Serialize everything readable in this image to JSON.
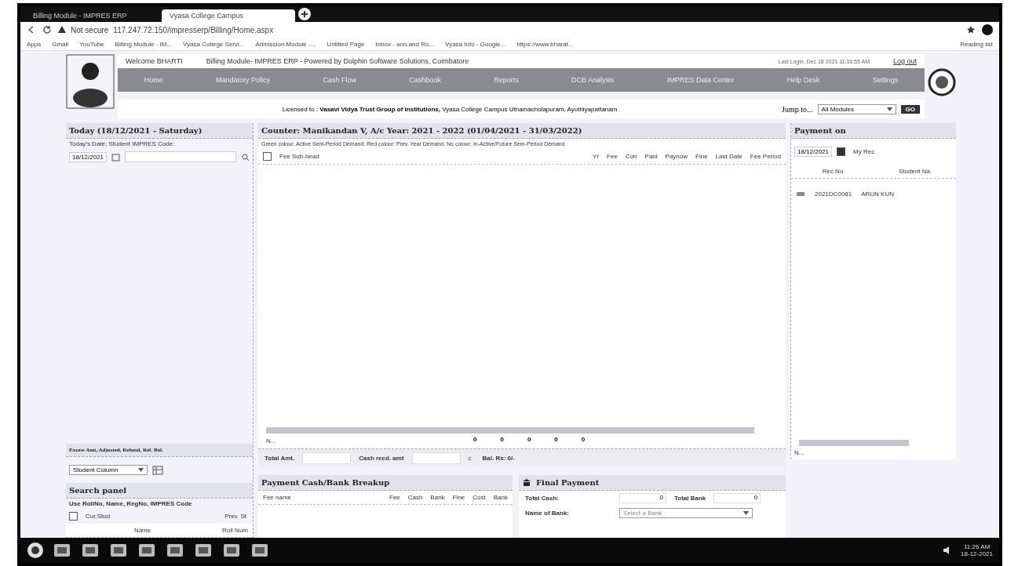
{
  "browser": {
    "tabs": [
      {
        "label": "Billing Module - IMPRES ERP",
        "selected": false
      },
      {
        "label": "Vyasa College Campus",
        "selected": true
      }
    ],
    "address": {
      "security": "Not secure",
      "url": "117.247.72.150/impresserp/Billing/Home.aspx"
    },
    "bookmarks": [
      "Apps",
      "Gmail",
      "YouTube",
      "Billing Module - IM...",
      "Vyasa College Servi...",
      "Admission Module -...",
      "Untitled Page",
      "Inbox - ann.and Ro...",
      "Vyasa Info - Google...",
      "https://www.bharat..."
    ],
    "reading_list": "Reading list"
  },
  "header": {
    "welcome": "Welcome BHARTI",
    "title": "Billing Module- IMPRES ERP - Powered by Dolphin Software Solutions, Coimbatore",
    "last_login": "Last Login: Dec 18 2021 11:16:55 AM",
    "logout": "Log out",
    "nav": [
      "Home",
      "Mandatory Policy",
      "Cash Flow",
      "Cashbook",
      "Reports",
      "DCB Analysis",
      "IMPRES Data Center",
      "Help Desk",
      "Settings"
    ],
    "licensed_label": "Licensed to :",
    "licensee": "Vasavi Vidya Trust Group of Institutions,",
    "address": "Vyasa College Campus Uthamacholapuram, Ayothiyapattanam",
    "jump_label": "Jump to...",
    "jump_value": "All Modules",
    "go": "GO"
  },
  "left": {
    "title": "Today (18/12/2021 - Saturday)",
    "prompt": "Today's Date, Student IMPRES Code:",
    "date": "18/12/2021",
    "excess_title": "Excess Amt, Adjusted, Refund, Ref. Bal.",
    "excess_select": "Student Column",
    "search": {
      "title": "Search panel",
      "hint": "Use RollNo, Name, RegNo, IMPRES Code",
      "current_label": "Cur.Stud",
      "current_checked": false,
      "prev_label": "Prev. St",
      "columns": [
        "Name",
        "Roll Num"
      ]
    }
  },
  "center": {
    "title": "Counter: Manikandan V, A/c Year: 2021 - 2022 (01/04/2021 - 31/03/2022)",
    "legend": "Green colour: Active Sem-Period Demand. Red colour: Prev. Year Demand. No colour: In-Active/Future Sem-Period Demand",
    "select_all_checked": false,
    "columns": [
      "Fee Sub-head",
      "Yr",
      "Fee",
      "Con",
      "Paid",
      "Paynow",
      "Fine",
      "Last Date",
      "Fee Period"
    ],
    "footer_label": "N...",
    "footer_totals": [
      "0",
      "0",
      "0",
      "0",
      "0"
    ],
    "total_label": "Total Amt.",
    "cash_label": "Cash recd. amt",
    "cash_suffix": "c",
    "balance": "Bal. Rs: 0/-"
  },
  "breakup": {
    "title": "Payment Cash/Bank Breakup",
    "columns": [
      "Fee name",
      "Fee",
      "Cash",
      "Bank",
      "Fine",
      "Cost",
      "Bank"
    ]
  },
  "right": {
    "title": "Payment on",
    "date": "18/12/2021",
    "my_rec_label": "My Rec",
    "my_rec_checked": true,
    "columns": [
      "Rec No",
      "Student Na"
    ],
    "rows": [
      [
        "2021DC0081",
        "ARUN KUN"
      ]
    ],
    "footer_label": "N..."
  },
  "final": {
    "title": "Final Payment",
    "total_cash_label": "Total Cash:",
    "total_cash": "0",
    "total_bank_label": "Total Bank",
    "total_bank": "0",
    "bank_label": "Name of Bank:",
    "bank_placeholder": "Select a Bank"
  },
  "taskbar": {
    "time": "11:26 AM",
    "date": "18-12-2021"
  }
}
